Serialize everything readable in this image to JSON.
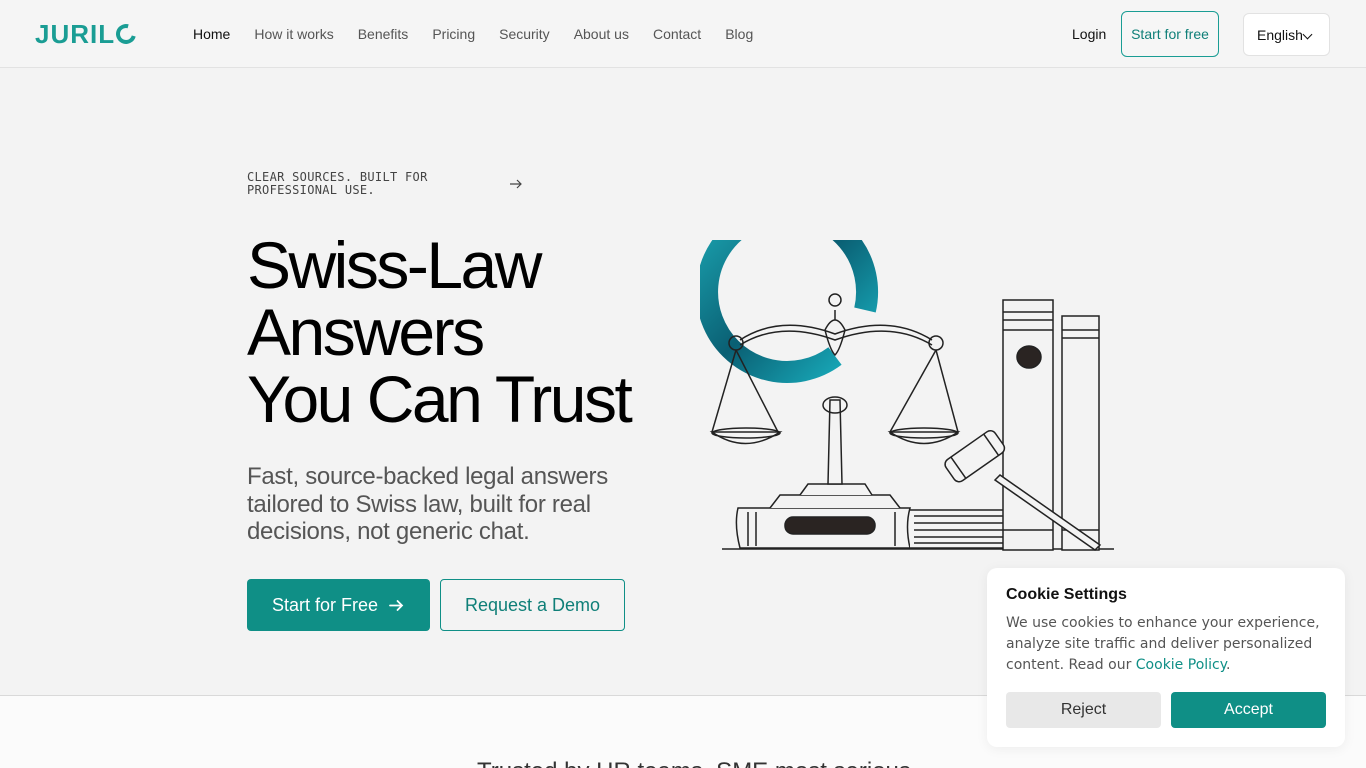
{
  "brand": {
    "logo_text": "JURIL",
    "accent": "#0f8f86"
  },
  "nav": {
    "items": [
      {
        "label": "Home",
        "active": true
      },
      {
        "label": "How it works"
      },
      {
        "label": "Benefits"
      },
      {
        "label": "Pricing"
      },
      {
        "label": "Security"
      },
      {
        "label": "About us"
      },
      {
        "label": "Contact"
      },
      {
        "label": "Blog"
      }
    ],
    "login": "Login",
    "start_free": "Start for free",
    "language": "English"
  },
  "hero": {
    "eyebrow": "CLEAR SOURCES. BUILT FOR PROFESSIONAL USE.",
    "title_lines": [
      "Swiss-Law",
      "Answers",
      "You Can Trust"
    ],
    "subtitle": "Fast, source-backed legal answers tailored to Swiss law, built for real decisions, not generic chat.",
    "cta_primary": "Start for Free",
    "cta_secondary": "Request a Demo"
  },
  "trusted": {
    "text": "Trusted by HR teams, SME most serious"
  },
  "cookie": {
    "title": "Cookie Settings",
    "text": "We use cookies to enhance your experience, analyze site traffic and deliver personalized content. Read our ",
    "policy_link": "Cookie Policy",
    "text_end": ".",
    "reject": "Reject",
    "accept": "Accept"
  }
}
